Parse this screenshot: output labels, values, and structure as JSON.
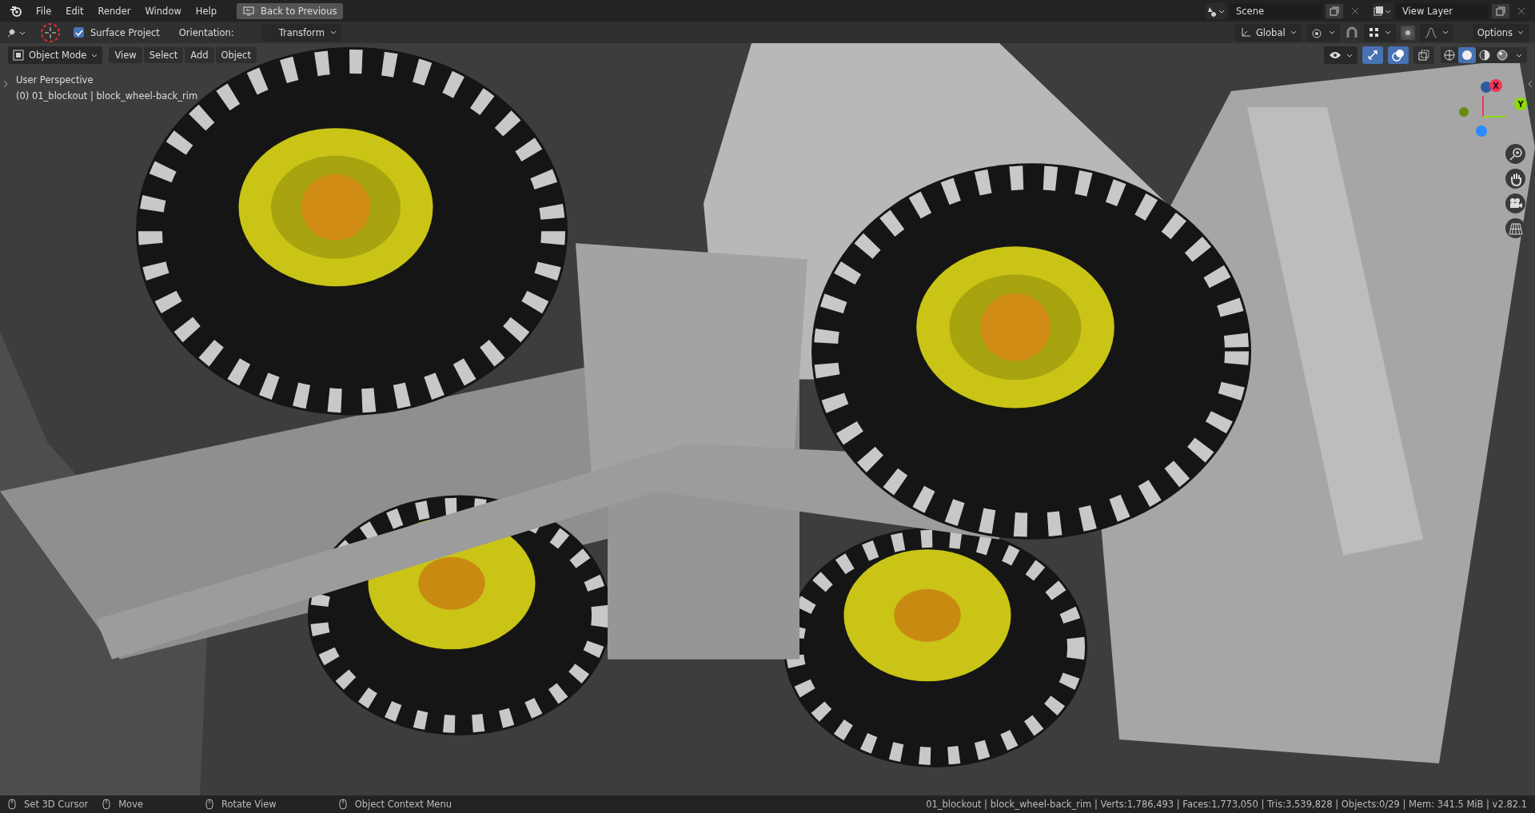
{
  "topbar": {
    "menus": [
      "File",
      "Edit",
      "Render",
      "Window",
      "Help"
    ],
    "back_button": "Back to Previous",
    "scene": "Scene",
    "view_layer": "View Layer"
  },
  "tool_header": {
    "surface_project": {
      "label": "Surface Project",
      "checked": true
    },
    "orientation_label": "Orientation:",
    "orientation": "Transform",
    "transform_space": "Global",
    "options": "Options"
  },
  "viewport_header": {
    "mode": "Object Mode",
    "menus": [
      "View",
      "Select",
      "Add",
      "Object"
    ],
    "toggles": [
      {
        "kind": "gizmo",
        "on": true
      },
      {
        "kind": "overlay",
        "on": true
      },
      {
        "kind": "xray",
        "on": false
      }
    ],
    "shading": [
      {
        "kind": "wireframe",
        "selected": false
      },
      {
        "kind": "solid",
        "selected": true
      },
      {
        "kind": "material",
        "selected": false
      },
      {
        "kind": "rendered",
        "selected": false
      }
    ]
  },
  "viewport": {
    "view_name": "User Perspective",
    "object_info": "(0) 01_blockout | block_wheel-back_rim",
    "gizmo_axes": [
      {
        "label": "X",
        "color": "#f5335a"
      },
      {
        "label": "Y",
        "color": "#8bdc00"
      }
    ]
  },
  "status_bar": {
    "hints": [
      "Set 3D Cursor",
      "Move",
      "Rotate View",
      "Object Context Menu"
    ],
    "stats": "01_blockout | block_wheel-back_rim | Verts:1,786,493 | Faces:1,773,050 | Tris:3,539,828 | Objects:0/29 | Mem: 341.5 MiB | v2.82.1"
  }
}
